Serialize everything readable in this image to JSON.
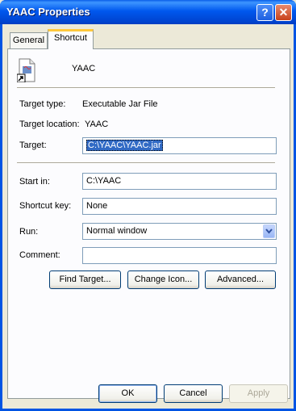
{
  "window": {
    "title": "YAAC Properties",
    "help_glyph": "?",
    "close_glyph": "✕"
  },
  "tabs": [
    {
      "label": "General",
      "active": false
    },
    {
      "label": "Shortcut",
      "active": true
    }
  ],
  "shortcut": {
    "name": "YAAC",
    "target_type_label": "Target type:",
    "target_type_value": "Executable Jar File",
    "target_location_label": "Target location:",
    "target_location_value": "YAAC",
    "target_label": "Target:",
    "target_value": "C:\\YAAC\\YAAC.jar",
    "start_in_label": "Start in:",
    "start_in_value": "C:\\YAAC",
    "shortcut_key_label": "Shortcut key:",
    "shortcut_key_value": "None",
    "run_label": "Run:",
    "run_value": "Normal window",
    "comment_label": "Comment:",
    "comment_value": "",
    "find_target_button": "Find Target...",
    "change_icon_button": "Change Icon...",
    "advanced_button": "Advanced..."
  },
  "footer": {
    "ok": "OK",
    "cancel": "Cancel",
    "apply": "Apply"
  },
  "colors": {
    "title_bar": "#0054e3",
    "selection": "#316ac5",
    "tab_highlight": "#ffc83c"
  }
}
